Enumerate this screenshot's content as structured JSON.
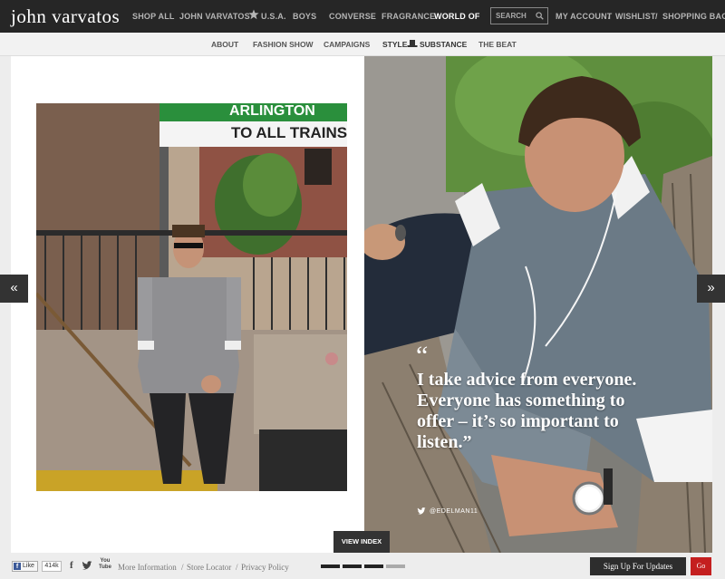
{
  "header": {
    "logo": "john varvatos",
    "nav": [
      "SHOP ALL",
      "JOHN VARVATOS",
      "U.S.A.",
      "BOYS",
      "CONVERSE",
      "FRAGRANCE",
      "WORLD OF"
    ],
    "search_placeholder": "SEARCH",
    "account": [
      "MY ACCOUNT",
      "WISHLIST",
      "SHOPPING BAG"
    ],
    "separator": "/"
  },
  "subnav": [
    "ABOUT",
    "FASHION SHOW",
    "CAMPAIGNS",
    "STYLE",
    "SUBSTANCE",
    "THE BEAT"
  ],
  "photo_left": {
    "sign_line1": "ARLINGTON",
    "sign_line2": "TO ALL TRAINS"
  },
  "arrows": {
    "prev": "«",
    "next": "»"
  },
  "quote": {
    "mark": "“",
    "text": "I take advice from everyone. Everyone has something to offer – it’s so important to listen.”",
    "handle": "@EDELMAN11"
  },
  "view_index": "VIEW INDEX",
  "footer": {
    "like_f": "f",
    "like_label": "Like",
    "like_count": "414k",
    "facebook": "f",
    "youtube_top": "You",
    "youtube_bottom": "Tube",
    "links": [
      "More Information",
      "Store Locator",
      "Privacy Policy"
    ],
    "link_separator": "/",
    "signup": "Sign Up For Updates",
    "go": "Go"
  },
  "colors": {
    "topbar": "#262626",
    "go_button": "#c41f1f",
    "sign_green": "#2a8f3c"
  }
}
